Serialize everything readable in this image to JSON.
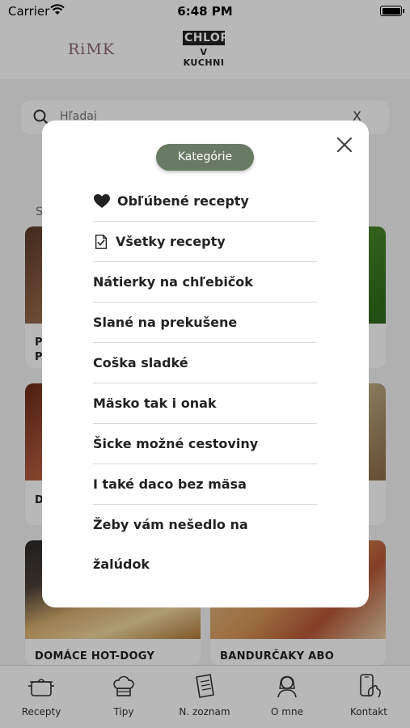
{
  "status_bar": {
    "carrier": "Carrier",
    "time": "6:48 PM"
  },
  "header": {
    "logo_left_text": "RiMK",
    "logo_right_line1": "CHLOP",
    "logo_right_line2": "V KUCHNI"
  },
  "search": {
    "placeholder": "Hľadaj",
    "clear_label": "X"
  },
  "background": {
    "section_letter": "S",
    "cards": [
      {
        "title": "P"
      },
      {
        "title": "P"
      },
      {
        "title": "D"
      },
      {
        "title": "DOMÁCE HOT-DOGY"
      },
      {
        "title": "BANDURČAKY ABO"
      }
    ]
  },
  "modal": {
    "heading": "Kategórie",
    "close_icon": "close-icon",
    "items": [
      {
        "label": "Obľúbené recepty",
        "icon": "heart-icon"
      },
      {
        "label": "Všetky recepty",
        "icon": "clipboard-check-icon"
      },
      {
        "label": "Nátierky na chľebičok"
      },
      {
        "label": "Slané na prekušene"
      },
      {
        "label": "Coška sladké"
      },
      {
        "label": "Mäsko tak i onak"
      },
      {
        "label": "Šicke možné cestoviny"
      },
      {
        "label": "I také daco bez mäsa"
      },
      {
        "label": "Žeby vám nešedlo na žalúdok"
      }
    ]
  },
  "tab_bar": {
    "items": [
      {
        "label": "Recepty",
        "icon": "pot-icon"
      },
      {
        "label": "Tipy",
        "icon": "chef-hat-icon"
      },
      {
        "label": "N. zoznam",
        "icon": "shopping-list-icon"
      },
      {
        "label": "O mne",
        "icon": "woman-avatar-icon"
      },
      {
        "label": "Kontakt",
        "icon": "phone-hand-icon"
      }
    ]
  },
  "colors": {
    "accent_green": "#697a64",
    "overlay": "rgba(0,0,0,0.28)"
  }
}
